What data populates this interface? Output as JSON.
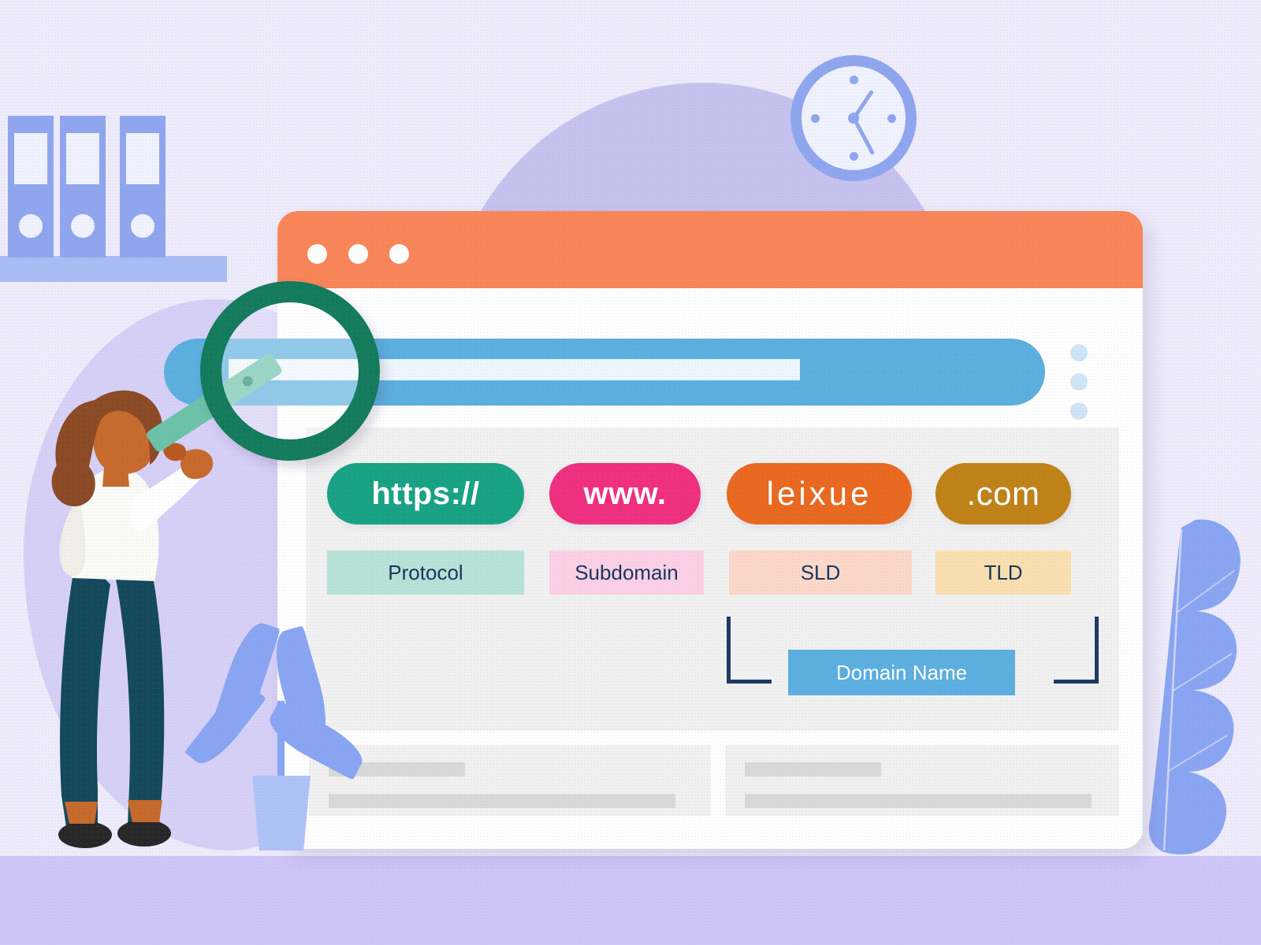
{
  "illustration": {
    "subject": "url-anatomy-diagram",
    "colors": {
      "background": "#eeebfb",
      "floor": "#cdc6f6",
      "dome": "#c6c2ef",
      "blob": "#d6d0f7",
      "browser_chrome": "#f98558",
      "browser_body": "#ffffff",
      "panel": "#f1f1f1",
      "search_bar": "#5bafdf",
      "magnifier": "#137b5b",
      "magnifier_handle": "#6cc2a8",
      "accent_navy": "#18355c",
      "decor_blue": "#8fa6ef",
      "shirt": "#fbfbf7",
      "pants": "#13495a",
      "hair": "#8b4a24",
      "skin": "#c66a2c",
      "shoes": "#272727"
    }
  },
  "browser": {
    "window_controls": [
      {
        "name": "dot-1"
      },
      {
        "name": "dot-2"
      },
      {
        "name": "dot-3"
      }
    ],
    "address_bar": {
      "value": "",
      "placeholder": ""
    },
    "overflow_menu": {
      "dots": 3
    }
  },
  "url_breakdown": {
    "segments": [
      {
        "id": "protocol",
        "pill_text": "https://",
        "pill_color": "#17a283",
        "label": "Protocol",
        "label_color": "#b6e2d7"
      },
      {
        "id": "subdomain",
        "pill_text": "www.",
        "pill_color": "#ef2f7e",
        "label": "Subdomain",
        "label_color": "#fbd0e6"
      },
      {
        "id": "sld",
        "pill_text": "leixue",
        "pill_color": "#e9681f",
        "label": "SLD",
        "label_color": "#fbd8c8"
      },
      {
        "id": "tld",
        "pill_text": ".com",
        "pill_color": "#c08116",
        "label": "TLD",
        "label_color": "#fadfaf"
      }
    ],
    "grouping": {
      "label": "Domain Name",
      "label_color": "#5bafdf",
      "covers": [
        "sld",
        "tld"
      ]
    },
    "full_url": "https://www.leixue.com"
  },
  "content_cards": [
    {
      "name": "card-left",
      "lines": 2
    },
    {
      "name": "card-right",
      "lines": 2
    }
  ],
  "decor": {
    "clock": {
      "name": "wall-clock",
      "hour_hand_deg": 34,
      "minute_hand_deg": 152,
      "reading": "1:25"
    },
    "binders": [
      {
        "name": "binder-1"
      },
      {
        "name": "binder-2"
      },
      {
        "name": "binder-3"
      }
    ],
    "shelf": {
      "name": "shelf-board"
    },
    "plant": {
      "name": "potted-plant",
      "leaves": 4
    },
    "oak_leaf": {
      "name": "oak-leaf"
    },
    "person": {
      "name": "woman-holding-magnifier",
      "pose": "back-view"
    },
    "magnifier": {
      "name": "magnifying-glass"
    }
  }
}
